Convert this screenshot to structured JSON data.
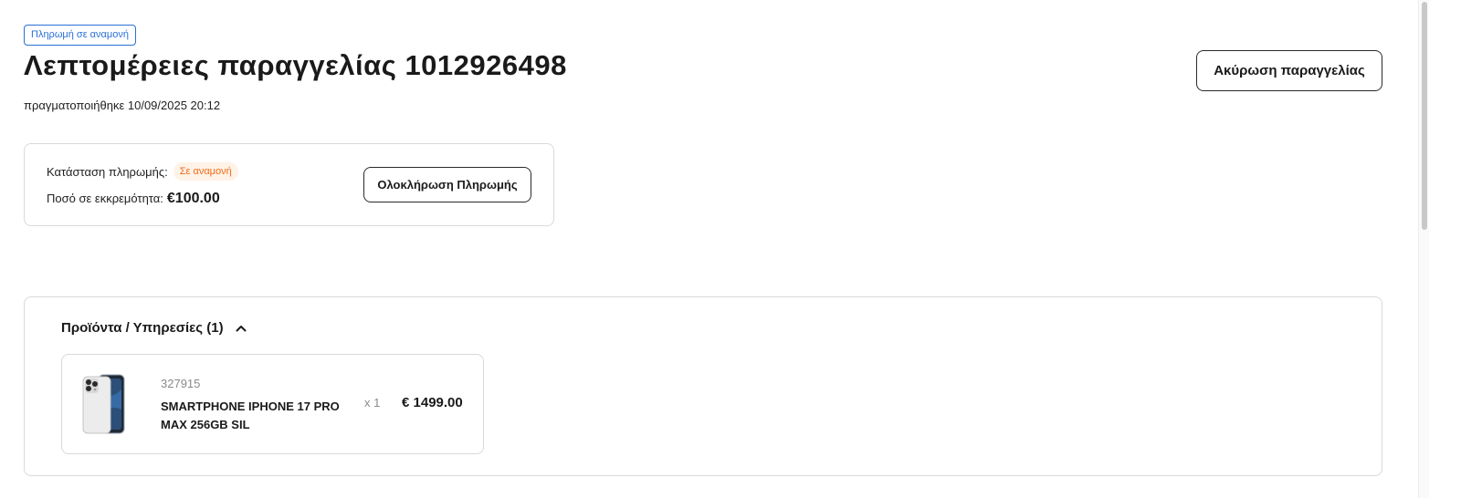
{
  "order": {
    "status_tag": "Πληρωμή σε αναμονή",
    "title": "Λεπτομέρειες παραγγελίας 1012926498",
    "placed_at": "πραγματοποιήθηκε 10/09/2025 20:12",
    "cancel_label": "Ακύρωση παραγγελίας"
  },
  "payment": {
    "status_label": "Κατάσταση πληρωμής:",
    "status_value": "Σε αναμονή",
    "pending_label": "Ποσό σε εκκρεμότητα:",
    "pending_amount": "€100.00",
    "complete_label": "Ολοκλήρωση Πληρωμής"
  },
  "products": {
    "header": "Προϊόντα / Υπηρεσίες (1)",
    "expanded": true,
    "items": [
      {
        "code": "327915",
        "name": "SMARTPHONE IPHONE 17 PRO MAX 256GB SIL",
        "qty": "x 1",
        "price": "€ 1499.00"
      }
    ]
  },
  "colors": {
    "accent_blue": "#2b6fd6",
    "pending_orange": "#ef6b1a",
    "pending_bg": "#fff2e6",
    "border": "#d9d9d9"
  },
  "icons": {
    "collapse": "chevron-up-icon",
    "product_image": "smartphone-image"
  }
}
